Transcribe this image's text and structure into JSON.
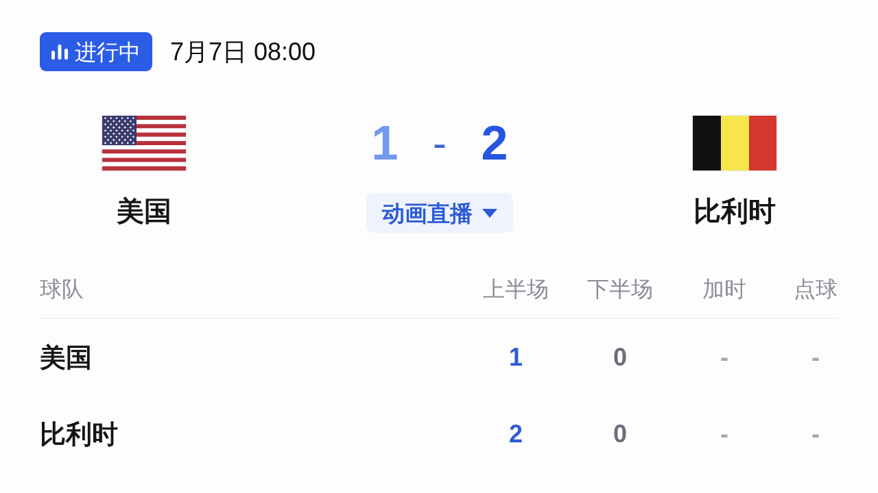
{
  "status_badge": {
    "label": "进行中"
  },
  "datetime": "7月7日 08:00",
  "match": {
    "teams": [
      {
        "name": "美国"
      },
      {
        "name": "比利时"
      }
    ],
    "score": [
      {
        "value": "1",
        "leading": false
      },
      {
        "value": "2",
        "leading": true
      }
    ],
    "separator": "-",
    "live_button": {
      "label": "动画直播"
    }
  },
  "table": {
    "columns": [
      "球队",
      "上半场",
      "下半场",
      "加时",
      "点球"
    ],
    "rows": [
      {
        "cells": [
          {
            "text": "美国",
            "kind": "team"
          },
          {
            "text": "1",
            "kind": "highlight"
          },
          {
            "text": "0",
            "kind": "value"
          },
          {
            "text": "-",
            "kind": "empty"
          },
          {
            "text": "-",
            "kind": "empty"
          }
        ]
      },
      {
        "cells": [
          {
            "text": "比利时",
            "kind": "team"
          },
          {
            "text": "2",
            "kind": "highlight"
          },
          {
            "text": "0",
            "kind": "value"
          },
          {
            "text": "-",
            "kind": "empty"
          },
          {
            "text": "-",
            "kind": "empty"
          }
        ]
      }
    ]
  }
}
